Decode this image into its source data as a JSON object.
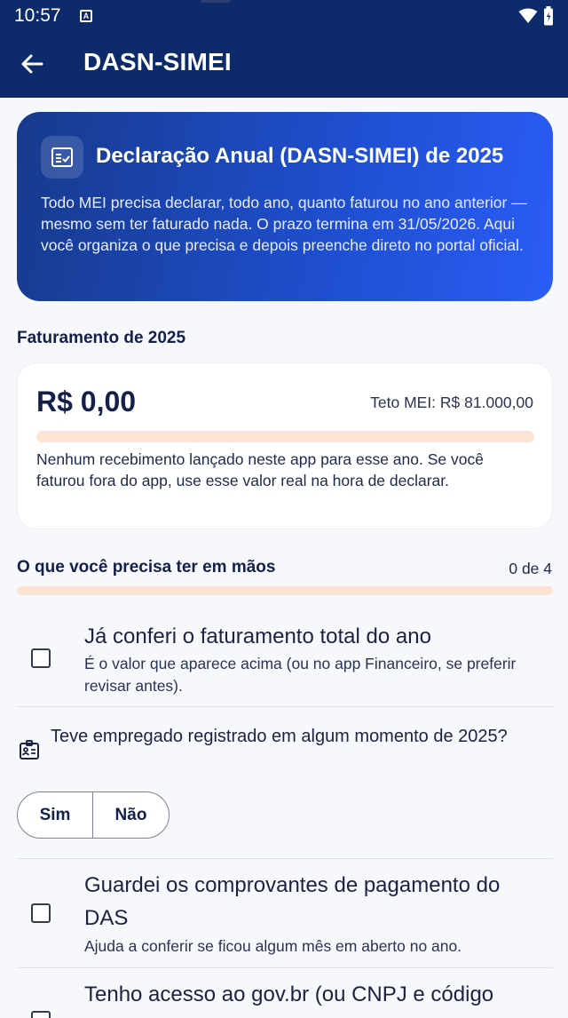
{
  "status_bar": {
    "time": "10:57",
    "notification_badge": "A"
  },
  "app_bar": {
    "title": "DASN-SIMEI"
  },
  "hero": {
    "title": "Declaração Anual (DASN-SIMEI) de 2025",
    "description": "Todo MEI precisa declarar, todo ano, quanto faturou no ano anterior — mesmo sem ter faturado nada. O prazo termina em 31/05/2026. Aqui você organiza o que precisa e depois preenche direto no portal oficial."
  },
  "faturamento": {
    "section_title": "Faturamento de 2025",
    "value": "R$ 0,00",
    "teto": "Teto MEI: R$ 81.000,00",
    "progress_fraction": 0,
    "note": "Nenhum recebimento lançado neste app para esse ano. Se você faturou fora do app, use esse valor real na hora de declarar."
  },
  "checklist": {
    "section_title": "O que você precisa ter em mãos",
    "counter": "0 de 4",
    "progress_fraction": 0,
    "items": [
      {
        "title": "Já conferi o faturamento total do ano",
        "subtitle": "É o valor que aparece acima (ou no app Financeiro, se preferir revisar antes).",
        "checked": false
      },
      {
        "question": "Teve empregado registrado em algum momento de 2025?",
        "options": [
          "Sim",
          "Não"
        ]
      },
      {
        "title": "Guardei os comprovantes de pagamento do DAS",
        "subtitle": "Ajuda a conferir se ficou algum mês em aberto no ano.",
        "checked": false
      },
      {
        "title": "Tenho acesso ao gov.br (ou CNPJ e código",
        "checked": false
      }
    ]
  },
  "colors": {
    "primary_dark": "#0d2a6b",
    "hero_gradient_end": "#2b5cf6",
    "progress_track": "#fde3d4"
  }
}
